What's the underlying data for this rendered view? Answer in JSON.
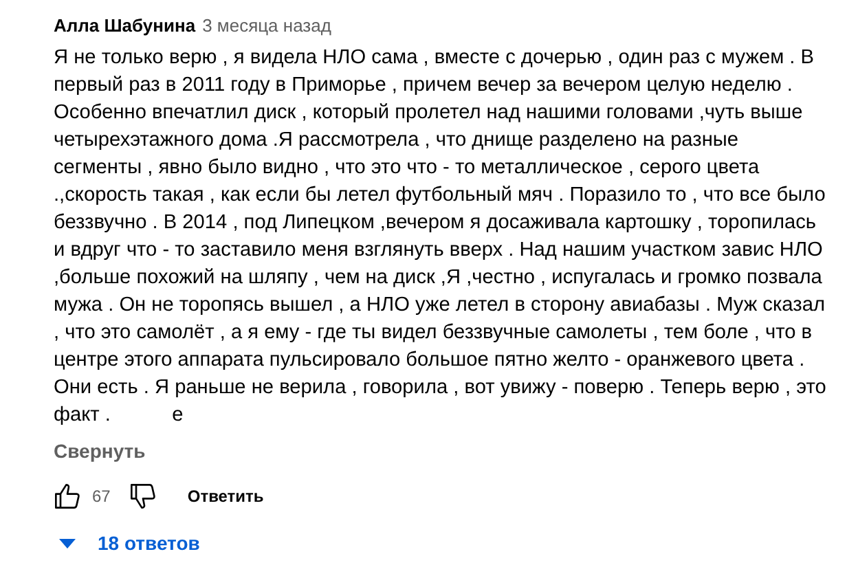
{
  "comment": {
    "author": "Алла Шабунина",
    "time": "3 месяца назад",
    "lines": [
      "Я не только верю , я видела НЛО сама , вместе с дочерью , один раз с мужем . В",
      "первый раз в 2011 году в Приморье , причем вечер за вечером целую неделю .",
      "Особенно впечатлил диск , который пролетел над нашими головами ,чуть выше",
      "четырехэтажного дома .Я рассмотрела , что днище разделено на разные",
      "сегменты , явно было видно , что это что - то металлическое , серого цвета",
      ".,скорость такая , как если бы летел футбольный мяч . Поразило то , что все было",
      "беззвучно . В 2014 , под Липецком ,вечером я досаживала картошку , торопилась",
      "и вдруг что - то заставило меня взглянуть вверх . Над нашим участком завис НЛО",
      ",больше похожий на шляпу , чем на диск ,Я ,честно , испугалась и громко позвала",
      "мужа . Он не торопясь вышел , а НЛО уже летел в сторону авиабазы . Муж сказал",
      ", что это самолёт , а я ему - где ты видел беззвучные самолеты , тем боле , что в",
      "центре этого аппарата пульсировало большое пятно желто - оранжевого цвета .",
      "Они есть . Я раньше не верила , говорила , вот увижу - поверю . Теперь верю , это",
      "факт .           е"
    ],
    "collapse": "Свернуть",
    "likes": "67",
    "reply": "Ответить",
    "replies": "18 ответов"
  }
}
